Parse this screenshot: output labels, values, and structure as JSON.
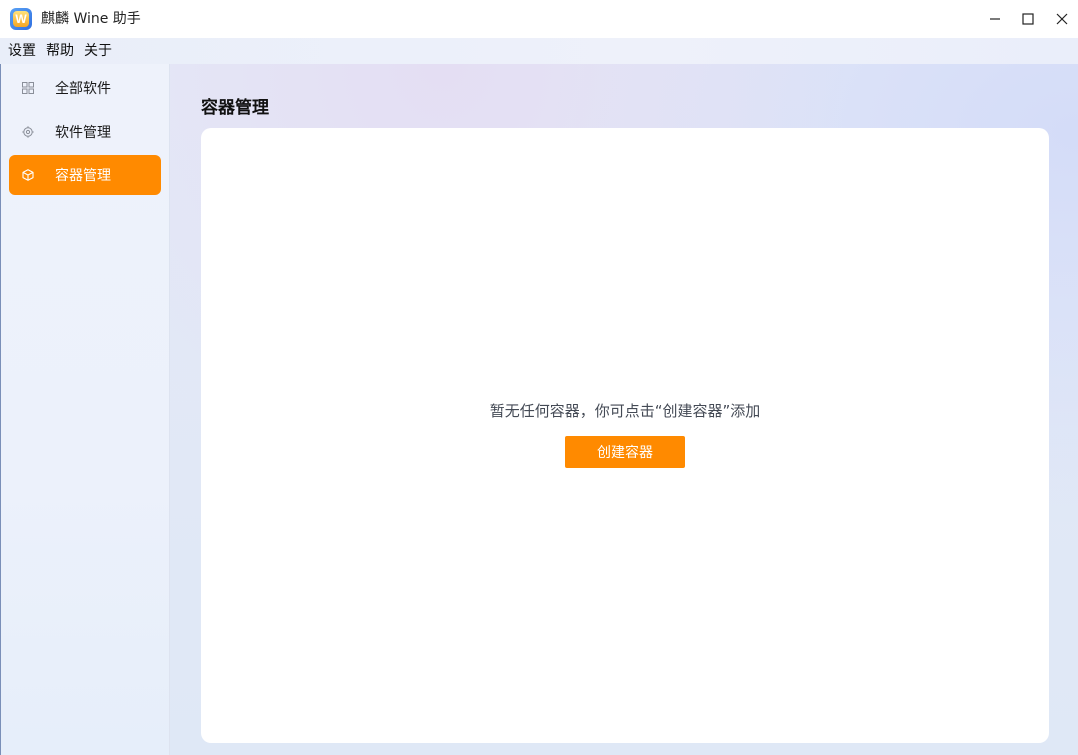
{
  "window": {
    "title": "麒麟 Wine 助手",
    "icon_letter": "W",
    "controls": {
      "minimize": "minimize-icon",
      "maximize": "maximize-icon",
      "close": "close-icon"
    }
  },
  "menubar": {
    "items": [
      {
        "label": "设置"
      },
      {
        "label": "帮助"
      },
      {
        "label": "关于"
      }
    ]
  },
  "sidebar": {
    "items": [
      {
        "label": "全部软件",
        "icon": "grid-icon",
        "active": false
      },
      {
        "label": "软件管理",
        "icon": "gear-icon",
        "active": false
      },
      {
        "label": "容器管理",
        "icon": "box-icon",
        "active": true
      }
    ]
  },
  "main": {
    "title": "容器管理",
    "empty_message": "暂无任何容器，你可点击“创建容器”添加",
    "create_button_label": "创建容器"
  },
  "colors": {
    "accent": "#ff8a00",
    "active_text": "#ffffff"
  }
}
